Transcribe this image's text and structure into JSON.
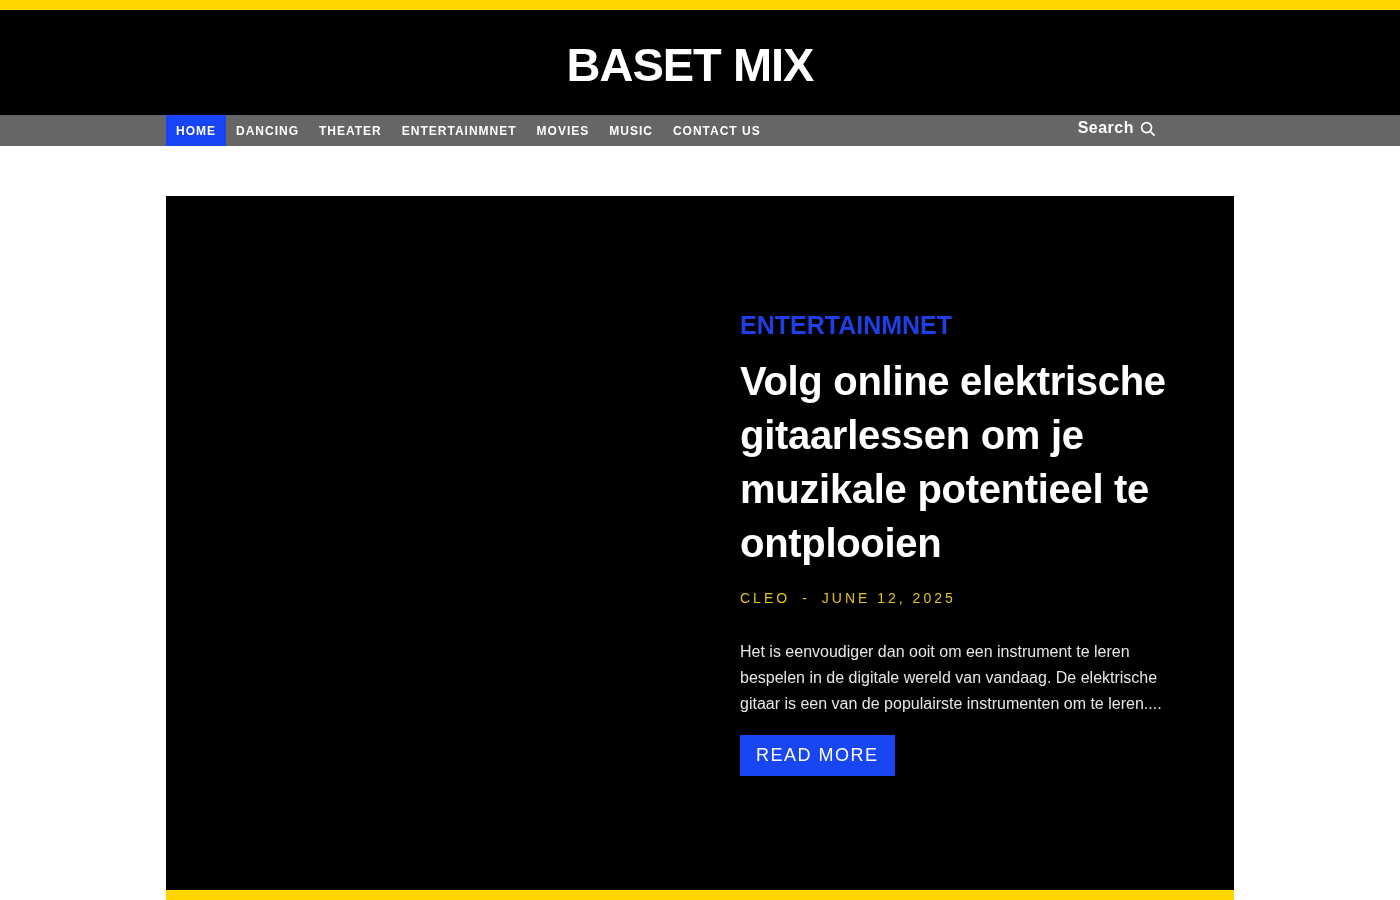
{
  "site": {
    "logo": "BASET MIX"
  },
  "nav": {
    "items": [
      {
        "label": "HOME",
        "selected": true
      },
      {
        "label": "DANCING",
        "selected": false
      },
      {
        "label": "THEATER",
        "selected": false
      },
      {
        "label": "ENTERTAINMNET",
        "selected": false
      },
      {
        "label": "MOVIES",
        "selected": false
      },
      {
        "label": "MUSIC",
        "selected": false
      },
      {
        "label": "CONTACT US",
        "selected": false
      }
    ],
    "search": {
      "label": "Search"
    }
  },
  "featured": {
    "category": "ENTERTAINMNET",
    "title": "Volg online elektrische gitaarlessen om je muzikale potentieel te ontplooien",
    "author": "CLEO",
    "separator": "-",
    "date": "JUNE 12, 2025",
    "excerpt": "Het is eenvoudiger dan ooit om een instrument te leren bespelen in de digitale wereld van vandaag. De elektrische gitaar is een van de populairste instrumenten om te leren....",
    "button": "READ MORE"
  }
}
